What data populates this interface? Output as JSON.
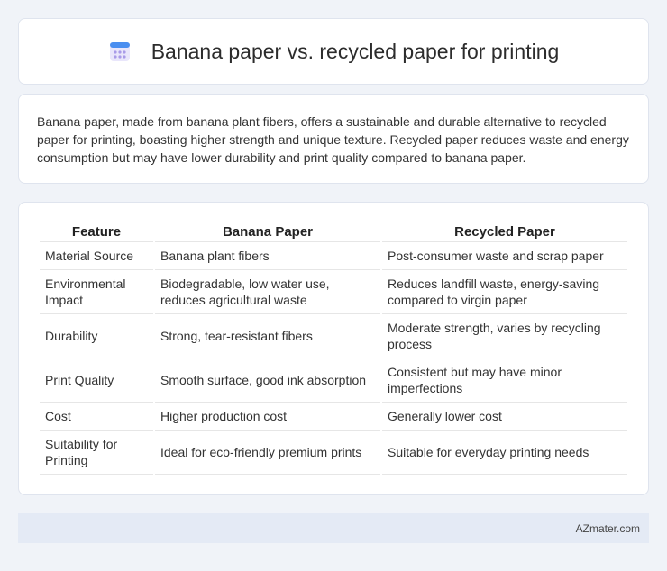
{
  "header": {
    "title": "Banana paper vs. recycled paper for printing",
    "icon": "calendar-icon"
  },
  "summary": {
    "text": "Banana paper, made from banana plant fibers, offers a sustainable and durable alternative to recycled paper for printing, boasting higher strength and unique texture. Recycled paper reduces waste and energy consumption but may have lower durability and print quality compared to banana paper."
  },
  "table": {
    "headers": [
      "Feature",
      "Banana Paper",
      "Recycled Paper"
    ],
    "rows": [
      [
        "Material Source",
        "Banana plant fibers",
        "Post-consumer waste and scrap paper"
      ],
      [
        "Environmental Impact",
        "Biodegradable, low water use, reduces agricultural waste",
        "Reduces landfill waste, energy-saving compared to virgin paper"
      ],
      [
        "Durability",
        "Strong, tear-resistant fibers",
        "Moderate strength, varies by recycling process"
      ],
      [
        "Print Quality",
        "Smooth surface, good ink absorption",
        "Consistent but may have minor imperfections"
      ],
      [
        "Cost",
        "Higher production cost",
        "Generally lower cost"
      ],
      [
        "Suitability for Printing",
        "Ideal for eco-friendly premium prints",
        "Suitable for everyday printing needs"
      ]
    ]
  },
  "footer": {
    "brand": "AZmater.com"
  }
}
